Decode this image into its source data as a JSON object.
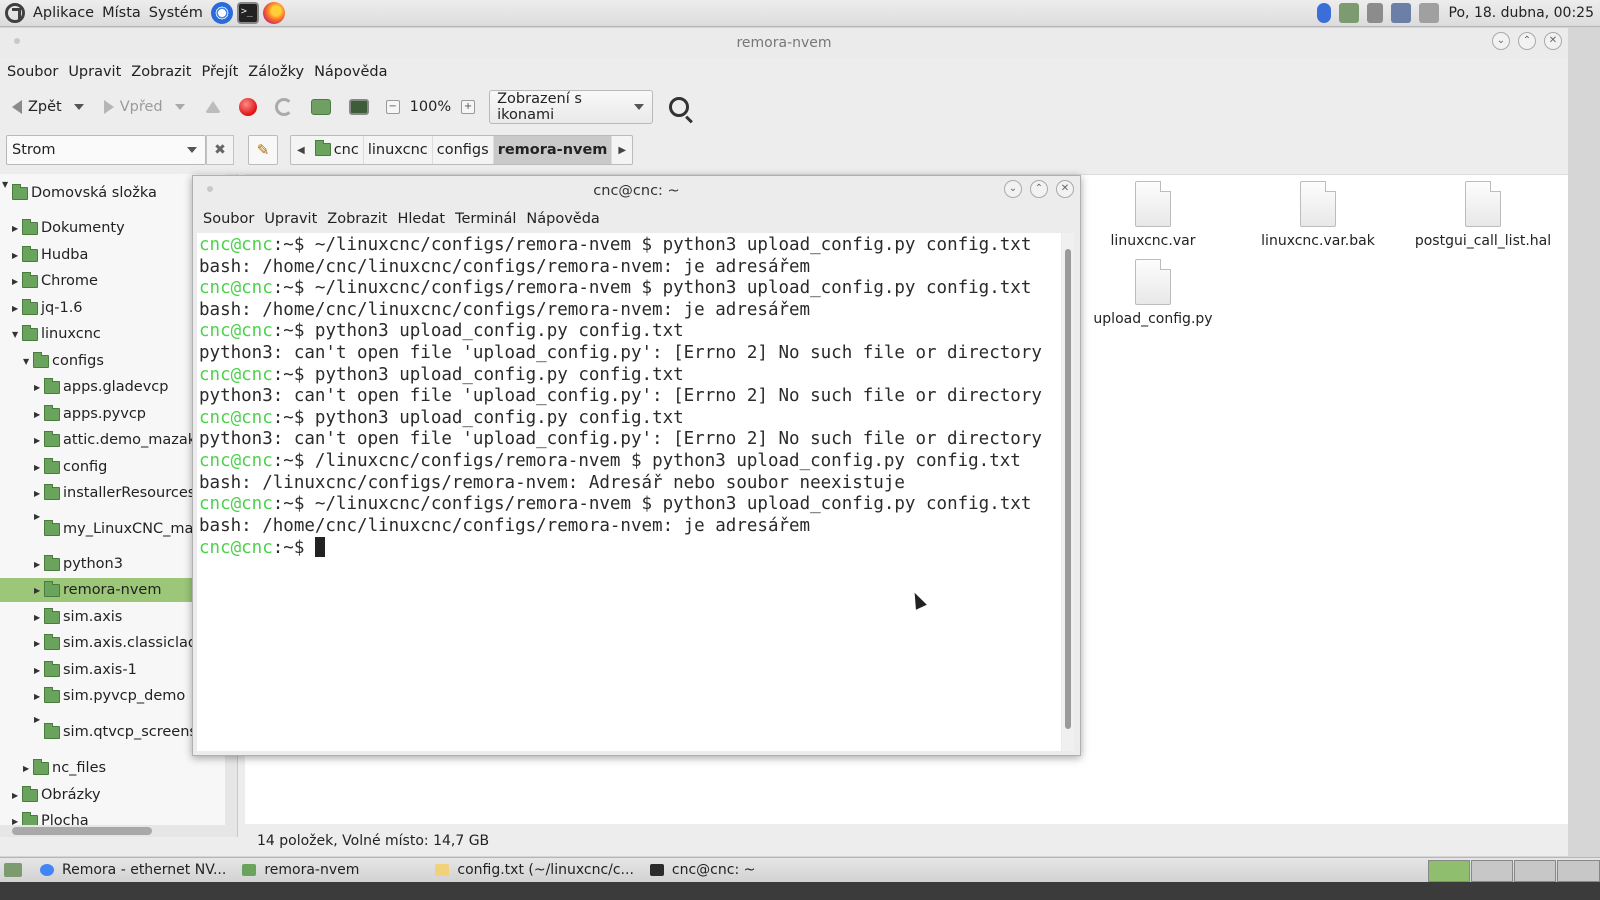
{
  "top_panel": {
    "menus": [
      "Aplikace",
      "Místa",
      "Systém"
    ],
    "clock": "Po, 18. dubna, 00:25"
  },
  "file_manager": {
    "title": "remora-nvem",
    "menubar": [
      "Soubor",
      "Upravit",
      "Zobrazit",
      "Přejít",
      "Záložky",
      "Nápověda"
    ],
    "back_label": "Zpět",
    "forward_label": "Vpřed",
    "zoom": "100%",
    "view_mode": "Zobrazení s ikonami",
    "sidebar_mode": "Strom",
    "breadcrumbs": [
      "cnc",
      "linuxcnc",
      "configs",
      "remora-nvem"
    ],
    "tree": [
      {
        "label": "Domovská složka"
      },
      {
        "label": "Dokumenty"
      },
      {
        "label": "Hudba"
      },
      {
        "label": "Chrome"
      },
      {
        "label": "jq-1.6"
      },
      {
        "label": "linuxcnc"
      },
      {
        "label": "configs"
      },
      {
        "label": "apps.gladevcp"
      },
      {
        "label": "apps.pyvcp"
      },
      {
        "label": "attic.demo_mazak"
      },
      {
        "label": "config"
      },
      {
        "label": "installerResources"
      },
      {
        "label": "my_LinuxCNC_mac"
      },
      {
        "label": "python3"
      },
      {
        "label": "remora-nvem"
      },
      {
        "label": "sim.axis"
      },
      {
        "label": "sim.axis.classicladde"
      },
      {
        "label": "sim.axis-1"
      },
      {
        "label": "sim.pyvcp_demo"
      },
      {
        "label": "sim.qtvcp_screens.c"
      },
      {
        "label": "nc_files"
      },
      {
        "label": "Obrázky"
      },
      {
        "label": "Plocha"
      }
    ],
    "files": [
      "linuxcnc.var",
      "linuxcnc.var.bak",
      "postgui_call_list.hal",
      "upload_config.py"
    ],
    "status": "14 položek, Volné místo: 14,7 GB"
  },
  "terminal": {
    "title": "cnc@cnc: ~",
    "menubar": [
      "Soubor",
      "Upravit",
      "Zobrazit",
      "Hledat",
      "Terminál",
      "Nápověda"
    ],
    "prompt_user": "cnc@cnc",
    "prompt_rest": ":~$ ",
    "lines": [
      {
        "type": "prompt",
        "text": "~/linuxcnc/configs/remora-nvem $ python3 upload_config.py config.txt"
      },
      {
        "type": "out",
        "text": "bash: /home/cnc/linuxcnc/configs/remora-nvem: je adresářem"
      },
      {
        "type": "prompt",
        "text": "~/linuxcnc/configs/remora-nvem $ python3 upload_config.py config.txt"
      },
      {
        "type": "out",
        "text": "bash: /home/cnc/linuxcnc/configs/remora-nvem: je adresářem"
      },
      {
        "type": "prompt",
        "text": "python3 upload_config.py config.txt"
      },
      {
        "type": "out",
        "text": "python3: can't open file 'upload_config.py': [Errno 2] No such file or directory"
      },
      {
        "type": "prompt",
        "text": "python3 upload_config.py config.txt"
      },
      {
        "type": "out",
        "text": "python3: can't open file 'upload_config.py': [Errno 2] No such file or directory"
      },
      {
        "type": "prompt",
        "text": "python3 upload_config.py config.txt"
      },
      {
        "type": "out",
        "text": "python3: can't open file 'upload_config.py': [Errno 2] No such file or directory"
      },
      {
        "type": "prompt",
        "text": "/linuxcnc/configs/remora-nvem $ python3 upload_config.py config.txt"
      },
      {
        "type": "out",
        "text": "bash: /linuxcnc/configs/remora-nvem: Adresář nebo soubor neexistuje"
      },
      {
        "type": "prompt",
        "text": "~/linuxcnc/configs/remora-nvem $ python3 upload_config.py config.txt"
      },
      {
        "type": "out",
        "text": "bash: /home/cnc/linuxcnc/configs/remora-nvem: je adresářem"
      },
      {
        "type": "prompt",
        "text": ""
      }
    ]
  },
  "taskbar": {
    "tasks": [
      "Remora - ethernet NV...",
      "remora-nvem",
      "config.txt (~/linuxcnc/c...",
      "cnc@cnc: ~"
    ]
  },
  "colors": {
    "prompt_green": "#4dd14d",
    "selection_green": "#9cc779",
    "folder_green": "#6aa35c"
  }
}
